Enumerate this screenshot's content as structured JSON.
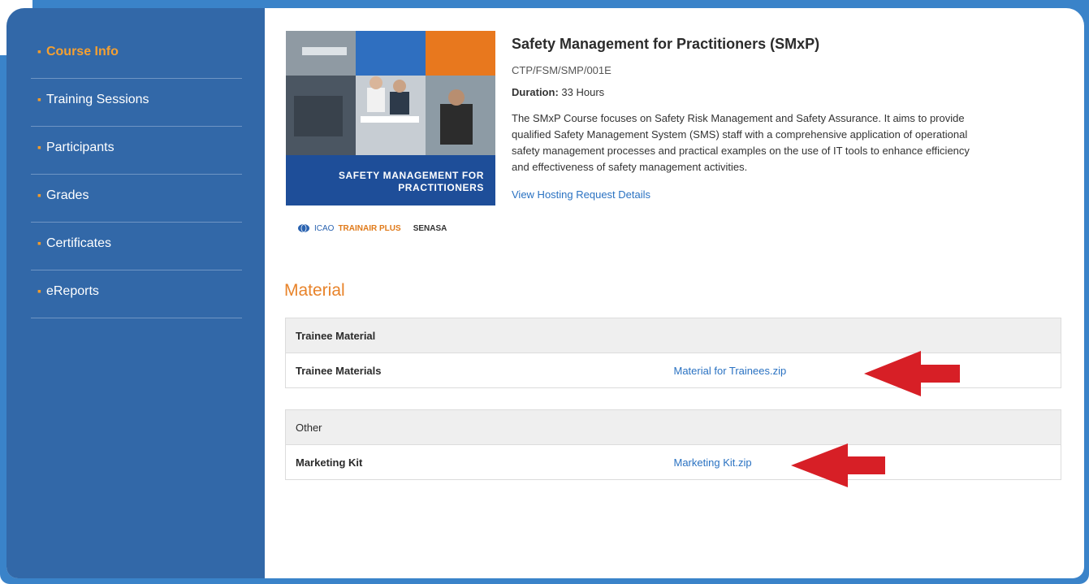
{
  "sidebar": {
    "items": [
      {
        "label": "Course Info",
        "active": true
      },
      {
        "label": "Training Sessions",
        "active": false
      },
      {
        "label": "Participants",
        "active": false
      },
      {
        "label": "Grades",
        "active": false
      },
      {
        "label": "Certificates",
        "active": false
      },
      {
        "label": "eReports",
        "active": false
      }
    ]
  },
  "course": {
    "title": "Safety Management for Practitioners (SMxP)",
    "code": "CTP/FSM/SMP/001E",
    "duration_label": "Duration:",
    "duration_value": " 33 Hours",
    "description": "The SMxP Course focuses on Safety Risk Management and Safety Assurance. It aims to provide qualified Safety Management System (SMS) staff with a comprehensive application of operational safety management processes and practical examples on the use of IT tools to enhance efficiency and effectiveness of safety management activities.",
    "hosting_link": "View Hosting Request Details",
    "cover": {
      "banner_line1": "SAFETY MANAGEMENT FOR",
      "banner_line2": "PRACTITIONERS",
      "logo_icao": "ICAO",
      "logo_trainair": "TRAINAIR PLUS",
      "logo_senasa": "SENASA"
    }
  },
  "material": {
    "heading": "Material",
    "groups": [
      {
        "group_label": "Trainee Material",
        "rows": [
          {
            "label": "Trainee Materials",
            "file": "Material for Trainees.zip"
          }
        ]
      },
      {
        "group_label": "Other",
        "rows": [
          {
            "label": "Marketing Kit",
            "file": "Marketing Kit.zip"
          }
        ]
      }
    ]
  },
  "colors": {
    "sidebar_bg": "#3268a8",
    "accent_orange": "#f29b2b",
    "link_blue": "#2a72c2",
    "arrow_red": "#d71f26"
  }
}
